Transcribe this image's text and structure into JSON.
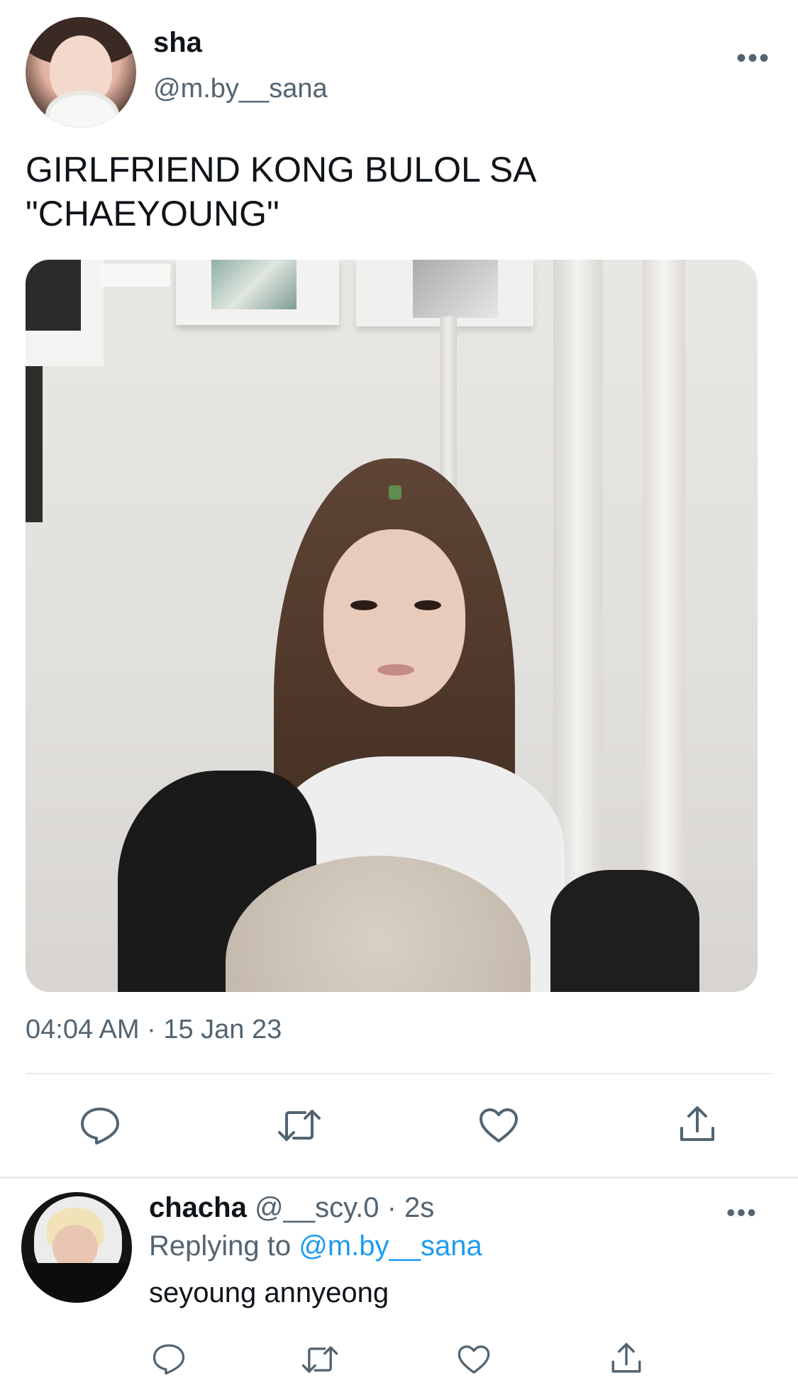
{
  "tweet": {
    "author_name": "sha",
    "author_handle": "@m.by__sana",
    "more_label": "•••",
    "text": "GIRLFRIEND KONG BULOL SA\n\"CHAEYOUNG\"",
    "timestamp": "04:04 AM · 15 Jan 23",
    "actions": [
      "reply-icon",
      "retweet-icon",
      "like-icon",
      "share-icon"
    ]
  },
  "reply": {
    "author_name": "chacha",
    "meta": " @__scy.0 · 2s",
    "replying_prefix": "Replying to ",
    "replying_to": "@m.by__sana",
    "text": "seyoung annyeong",
    "more_label": "•••",
    "actions": [
      "reply-icon",
      "retweet-icon",
      "like-icon",
      "share-icon"
    ]
  },
  "colors": {
    "text_primary": "#0f1419",
    "text_secondary": "#536471",
    "link": "#1d9bf0",
    "divider": "#e6ecf0"
  }
}
